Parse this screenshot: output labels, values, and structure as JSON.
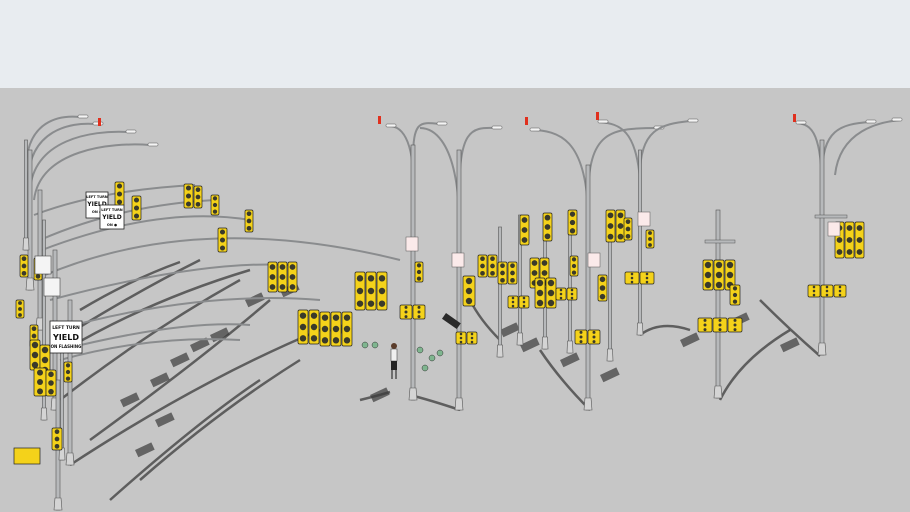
{
  "scene": {
    "sky_color": "#e8ecf0",
    "ground_color": "#c6c6c6",
    "pole_color": "#b7b9bb",
    "signal_color": "#f4d21a",
    "signal_dark": "#3a3a2a",
    "shadow_color": "#3b3b3b",
    "streetlight_marker_color": "#e0301e"
  },
  "signs": [
    {
      "id": "sign-1",
      "lines": [
        "LEFT TURN",
        "YIELD",
        "ON ●"
      ]
    },
    {
      "id": "sign-2",
      "lines": [
        "LEFT TURN",
        "YIELD",
        "ON ●"
      ]
    },
    {
      "id": "sign-3",
      "lines": [
        "LEFT TURN",
        "YIELD",
        "ON FLASHING"
      ]
    }
  ]
}
